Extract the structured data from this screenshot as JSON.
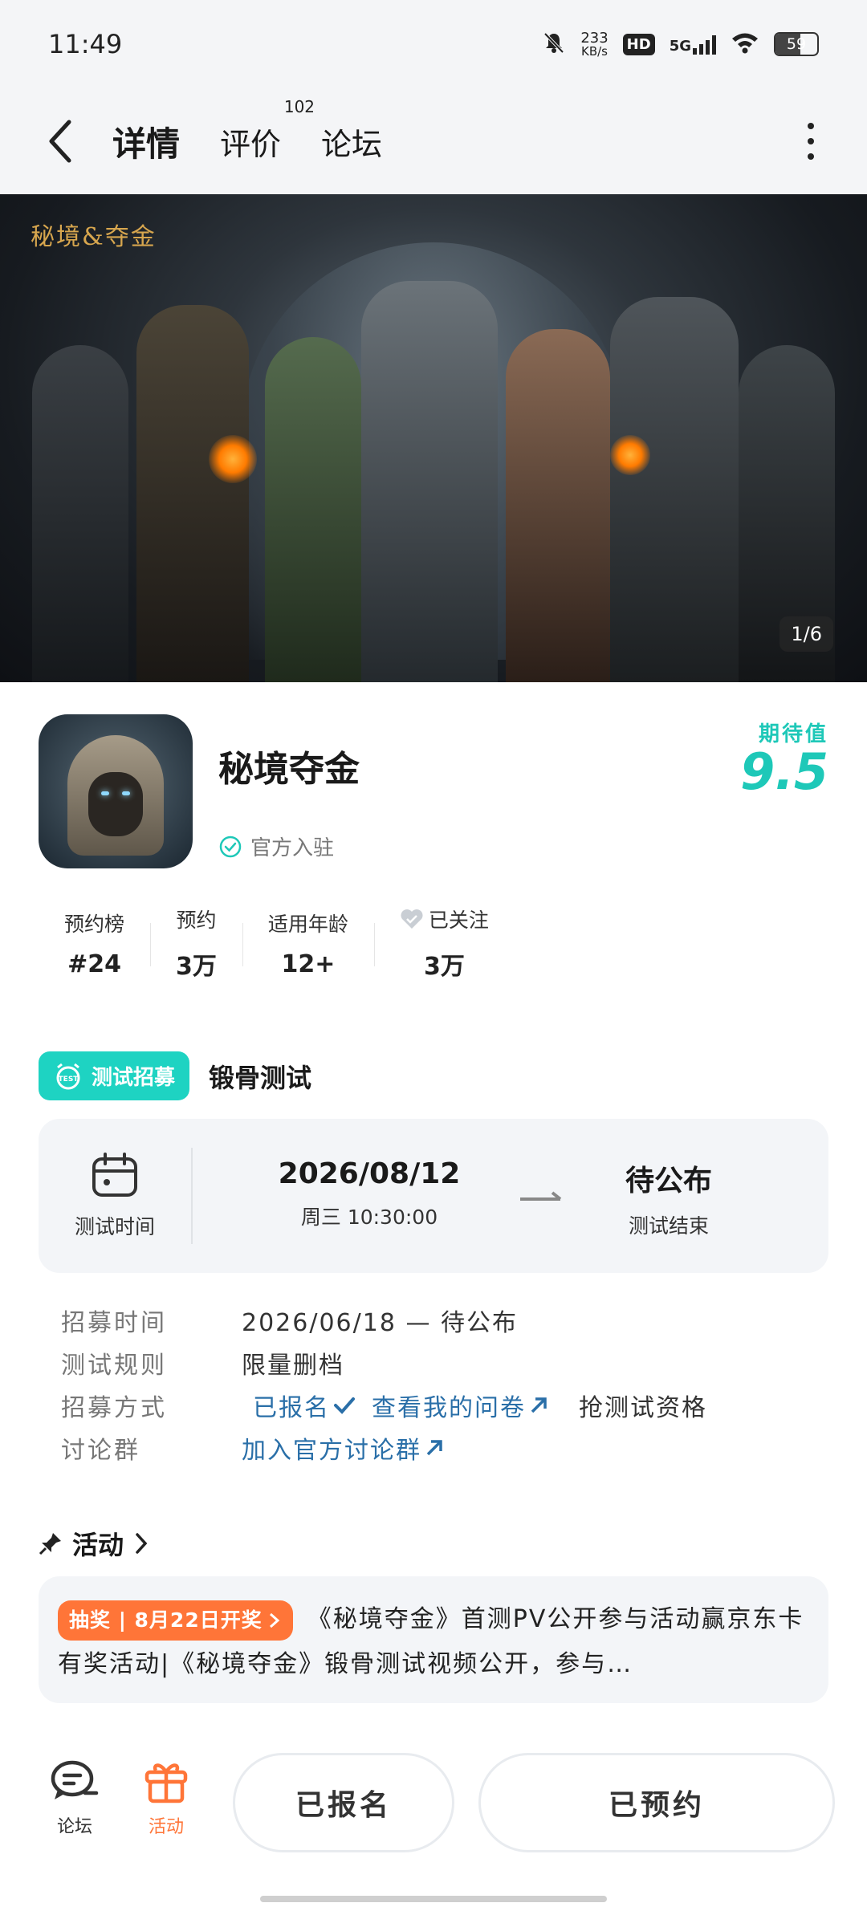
{
  "status_bar": {
    "time": "11:49",
    "net_speed_value": "233",
    "net_speed_unit": "KB/s",
    "hd": "HD",
    "network": "5G",
    "battery": "59"
  },
  "nav": {
    "tabs": [
      {
        "label": "详情",
        "active": true
      },
      {
        "label": "评价",
        "badge": "102"
      },
      {
        "label": "论坛"
      }
    ]
  },
  "banner": {
    "logo_text": "秘境&夺金",
    "page_indicator": "1/6"
  },
  "game": {
    "title": "秘境夺金",
    "verified_label": "官方入驻",
    "expect_label": "期待值",
    "expect_score": "9.5"
  },
  "stats": [
    {
      "label": "预约榜",
      "value": "#24"
    },
    {
      "label": "预约",
      "value": "3万"
    },
    {
      "label": "适用年龄",
      "value": "12+"
    },
    {
      "label": "已关注",
      "value": "3万"
    }
  ],
  "test": {
    "badge_label": "测试招募",
    "name": "锻骨测试",
    "time_label": "测试时间",
    "start_date": "2026/08/12",
    "start_time": "周三 10:30:00",
    "end_status": "待公布",
    "end_label": "测试结束"
  },
  "info": {
    "recruit_time_key": "招募时间",
    "recruit_time_val": "2026/06/18 — 待公布",
    "rules_key": "测试规则",
    "rules_val": "限量删档",
    "method_key": "招募方式",
    "signed_up": "已报名",
    "view_survey": "查看我的问卷",
    "grab_qualification": "抢测试资格",
    "group_key": "讨论群",
    "join_group": "加入官方讨论群"
  },
  "activity": {
    "heading": "活动",
    "badge": "抽奖 | 8月22日开奖",
    "text": "《秘境夺金》首测PV公开参与活动赢京东卡 有奖活动|《秘境夺金》锻骨测试视频公开，参与…"
  },
  "bottom": {
    "forum_label": "论坛",
    "activity_label": "活动",
    "signed_up_button": "已报名",
    "reserved_button": "已预约"
  },
  "colors": {
    "accent": "#1ed3c2",
    "link": "#2a6fa8",
    "activity_orange": "#ff7538"
  }
}
